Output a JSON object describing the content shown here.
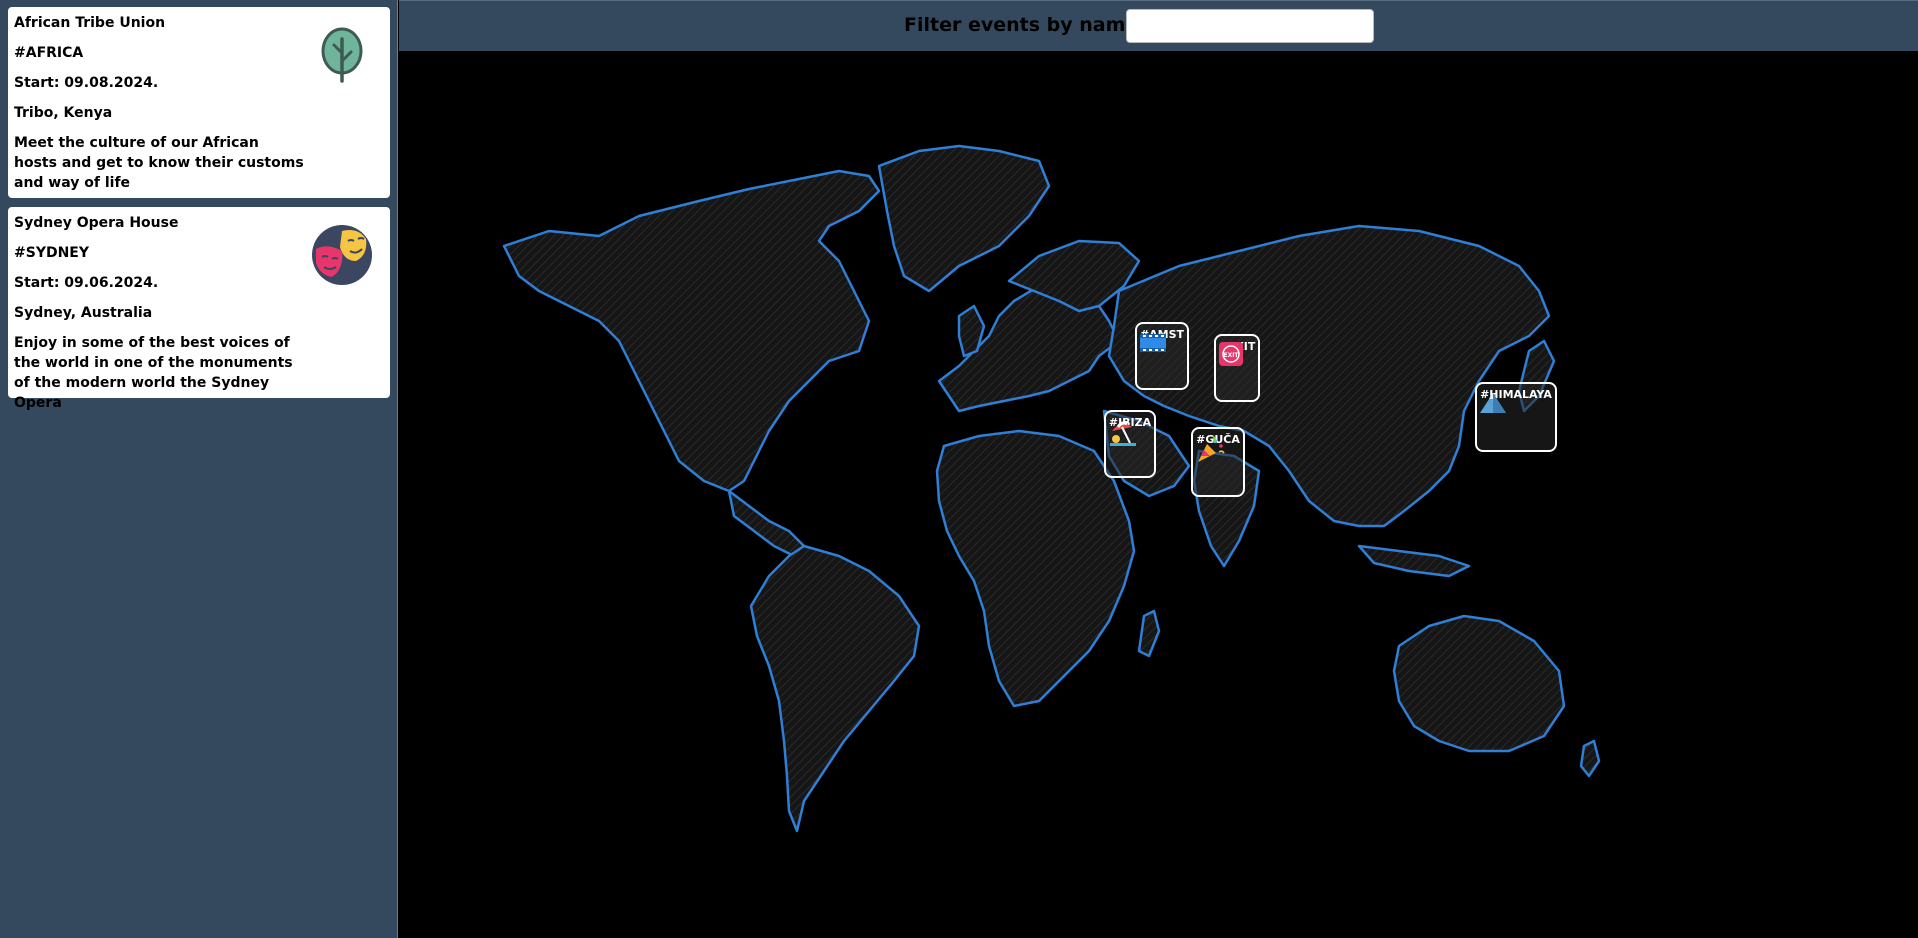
{
  "events": [
    {
      "title": "African Tribe Union",
      "tag": "#AFRICA",
      "start": "Start: 09.08.2024.",
      "location": "Tribo, Kenya",
      "description": "Meet the culture of our African hosts and get to know their customs and way of life",
      "icon": "tree-icon"
    },
    {
      "title": "Sydney Opera House",
      "tag": "#SYDNEY",
      "start": "Start: 09.06.2024.",
      "location": "Sydney, Australia",
      "description": "Enjoy in some of the best voices of the world in one of the monuments of the modern world the Sydney Opera",
      "icon": "theater-masks-icon"
    }
  ],
  "filter": {
    "label": "Filter events by name:",
    "value": ""
  },
  "markers": [
    {
      "label": "#AMST",
      "icon": "film-icon"
    },
    {
      "label": "#EXIT",
      "icon": "exit-badge-icon",
      "badge_text": "EXIT"
    },
    {
      "label": "#HIMALAYA",
      "icon": "mountain-icon"
    },
    {
      "label": "#IBIZA",
      "icon": "beach-icon"
    },
    {
      "label": "#GUČA",
      "icon": "party-popper-icon"
    }
  ],
  "colors": {
    "panel": "#34495e",
    "map_background": "#000000",
    "land_stroke": "#2f7fd6",
    "land_fill": "#1c1c1c"
  }
}
